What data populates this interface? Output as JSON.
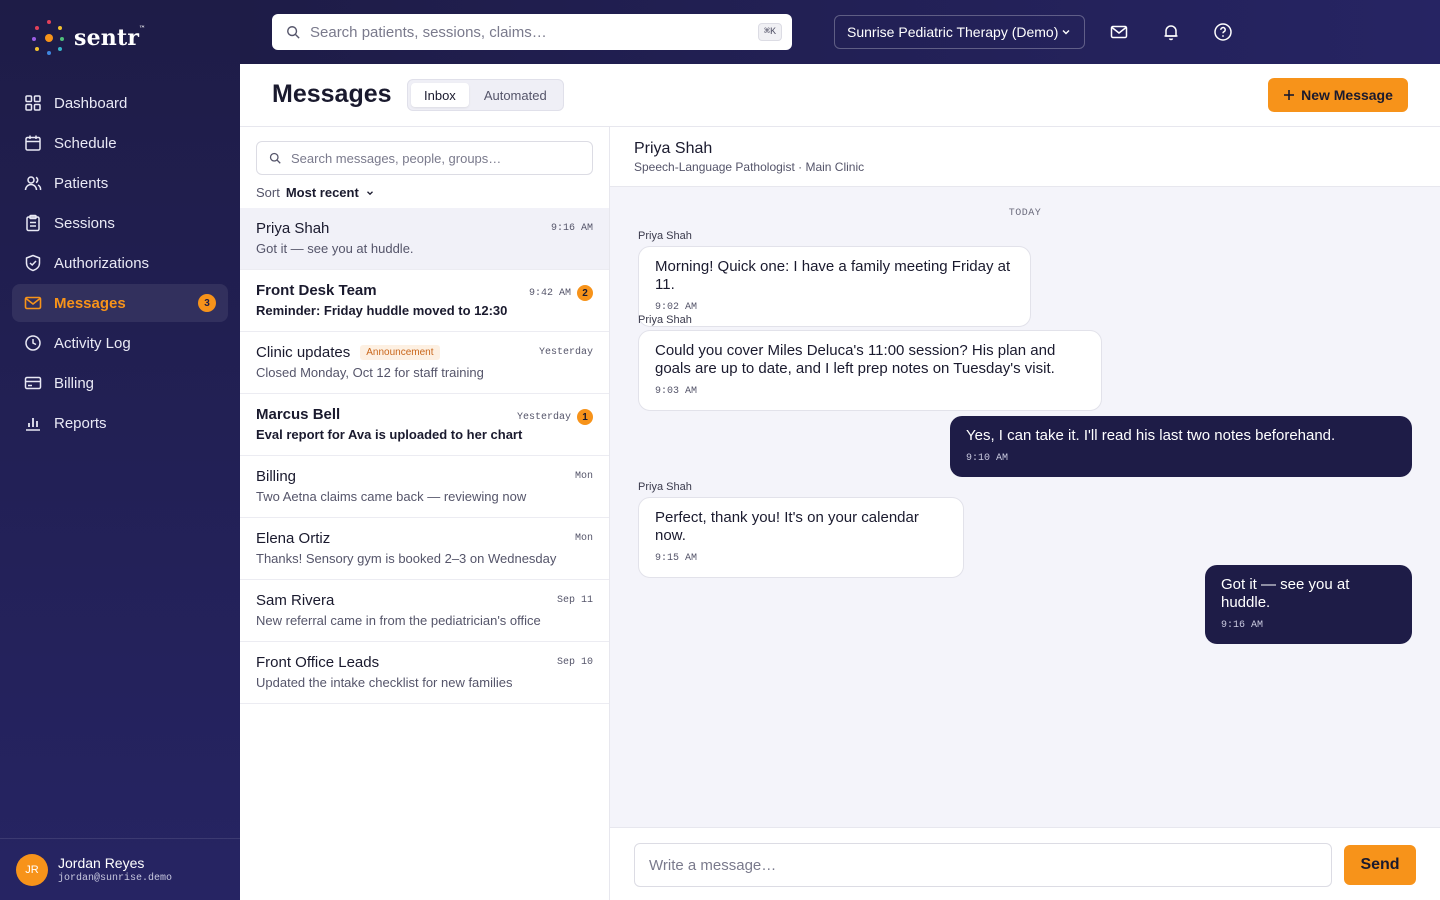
{
  "app": {
    "logo_text": "sentr",
    "logo_tm": "™"
  },
  "colors": {
    "accent": "#f7931a",
    "navy": "#1e1c47",
    "background": "#f4f4fa"
  },
  "sidebar": {
    "items": [
      {
        "label": "Dashboard",
        "icon": "dashboard-icon"
      },
      {
        "label": "Schedule",
        "icon": "calendar-icon"
      },
      {
        "label": "Patients",
        "icon": "users-icon"
      },
      {
        "label": "Sessions",
        "icon": "clipboard-icon"
      },
      {
        "label": "Authorizations",
        "icon": "shield-icon"
      },
      {
        "label": "Messages",
        "icon": "mail-icon",
        "badge": "3",
        "active": true
      },
      {
        "label": "Activity Log",
        "icon": "clock-icon"
      },
      {
        "label": "Billing",
        "icon": "credit-card-icon"
      },
      {
        "label": "Reports",
        "icon": "bar-chart-icon"
      }
    ],
    "user": {
      "initials": "JR",
      "name": "Jordan Reyes",
      "email": "jordan@sunrise.demo"
    }
  },
  "topbar": {
    "search_placeholder": "Search patients, sessions, claims…",
    "shortcut": "⌘K",
    "org": "Sunrise Pediatric Therapy (Demo)"
  },
  "header": {
    "title": "Messages",
    "tabs": [
      "Inbox",
      "Automated"
    ],
    "new_message": "New Message"
  },
  "list": {
    "search_placeholder": "Search messages, people, groups…",
    "sort_label": "Sort",
    "sort_value": "Most recent",
    "conversations": [
      {
        "name": "Priya Shah",
        "time": "9:16 AM",
        "preview": "Got it — see you at huddle.",
        "badge": "",
        "tag": "",
        "selected": true,
        "unread": false
      },
      {
        "name": "Front Desk Team",
        "time": "9:42 AM",
        "preview": "Reminder: Friday huddle moved to 12:30",
        "badge": "2",
        "tag": "",
        "selected": false,
        "unread": true
      },
      {
        "name": "Clinic updates",
        "time": "Yesterday",
        "preview": "Closed Monday, Oct 12 for staff training",
        "badge": "",
        "tag": "Announcement",
        "selected": false,
        "unread": false
      },
      {
        "name": "Marcus Bell",
        "time": "Yesterday",
        "preview": "Eval report for Ava is uploaded to her chart",
        "badge": "1",
        "tag": "",
        "selected": false,
        "unread": true
      },
      {
        "name": "Billing",
        "time": "Mon",
        "preview": "Two Aetna claims came back — reviewing now",
        "badge": "",
        "tag": "",
        "selected": false,
        "unread": false
      },
      {
        "name": "Elena Ortiz",
        "time": "Mon",
        "preview": "Thanks! Sensory gym is booked 2–3 on Wednesday",
        "badge": "",
        "tag": "",
        "selected": false,
        "unread": false
      },
      {
        "name": "Sam Rivera",
        "time": "Sep 11",
        "preview": "New referral came in from the pediatrician's office",
        "badge": "",
        "tag": "",
        "selected": false,
        "unread": false
      },
      {
        "name": "Front Office Leads",
        "time": "Sep 10",
        "preview": "Updated the intake checklist for new families",
        "badge": "",
        "tag": "",
        "selected": false,
        "unread": false
      }
    ]
  },
  "thread": {
    "name": "Priya Shah",
    "role": "Speech-Language Pathologist · Main Clinic",
    "day_label": "TODAY",
    "messages": [
      {
        "sender": "Priya Shah",
        "text": "Morning! Quick one: I have a family meeting Friday at 11.",
        "time": "9:02 AM",
        "direction": "in"
      },
      {
        "sender": "Priya Shah",
        "text": "Could you cover Miles Deluca's 11:00 session? His plan and goals are up to date, and I left prep notes on Tuesday's visit.",
        "time": "9:03 AM",
        "direction": "in"
      },
      {
        "sender": "",
        "text": "Yes, I can take it. I'll read his last two notes beforehand.",
        "time": "9:10 AM",
        "direction": "out"
      },
      {
        "sender": "Priya Shah",
        "text": "Perfect, thank you! It's on your calendar now.",
        "time": "9:15 AM",
        "direction": "in"
      },
      {
        "sender": "",
        "text": "Got it — see you at huddle.",
        "time": "9:16 AM",
        "direction": "out"
      }
    ],
    "composer_placeholder": "Write a message…",
    "send_label": "Send"
  }
}
